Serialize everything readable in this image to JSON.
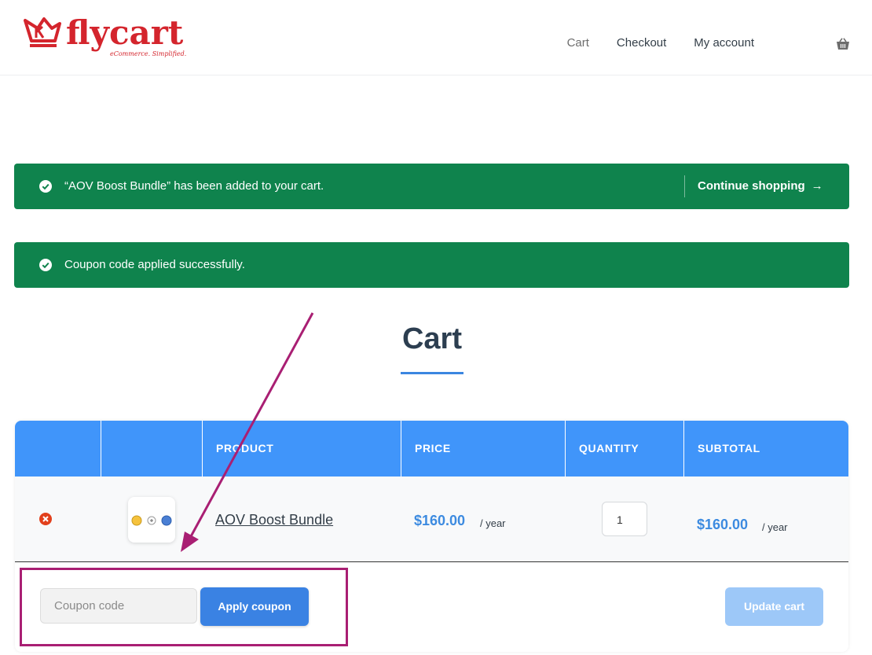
{
  "brand": {
    "name": "flycart",
    "tagline": "eCommerce. Simplified."
  },
  "nav": {
    "items": [
      {
        "label": "Cart"
      },
      {
        "label": "Checkout"
      },
      {
        "label": "My account"
      }
    ],
    "cart_icon": "basket-icon"
  },
  "notices": {
    "added": {
      "message": "“AOV Boost Bundle” has been added to your cart.",
      "continue_label": "Continue shopping",
      "arrow": "→"
    },
    "coupon": {
      "message": "Coupon code applied successfully."
    }
  },
  "page": {
    "title": "Cart"
  },
  "table": {
    "headers": [
      "",
      "",
      "PRODUCT",
      "PRICE",
      "QUANTITY",
      "SUBTOTAL"
    ],
    "rows": [
      {
        "product": "AOV Boost Bundle",
        "price": "$160.00",
        "price_period": "/ year",
        "quantity": "1",
        "subtotal": "$160.00",
        "subtotal_period": "/ year"
      }
    ]
  },
  "coupon": {
    "placeholder": "Coupon code",
    "apply_label": "Apply coupon"
  },
  "actions": {
    "update_label": "Update cart"
  },
  "colors": {
    "notice_bg": "#0f834d",
    "header_bg": "#4095fa",
    "accent": "#3a82e3",
    "brand_red": "#d4252d",
    "annotation": "#a91f73"
  }
}
